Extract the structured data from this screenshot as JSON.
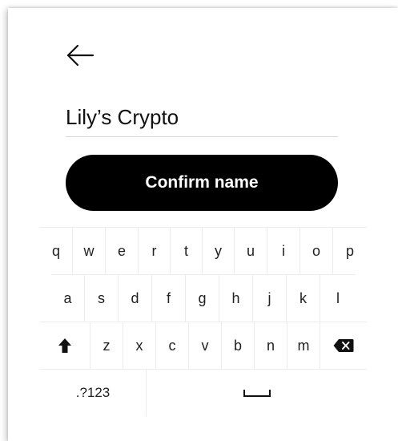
{
  "header": {
    "back_icon": "arrow-left-icon"
  },
  "name_input": {
    "value": "Lily’s Crypto"
  },
  "confirm_button": {
    "label": "Confirm name"
  },
  "keyboard": {
    "row1": [
      "q",
      "w",
      "e",
      "r",
      "t",
      "y",
      "u",
      "i",
      "o",
      "p"
    ],
    "row2": [
      "a",
      "s",
      "d",
      "f",
      "g",
      "h",
      "j",
      "k",
      "l"
    ],
    "row3": [
      "z",
      "x",
      "c",
      "v",
      "b",
      "n",
      "m"
    ],
    "shift_icon": "shift-arrow-icon",
    "backspace_icon": "backspace-icon",
    "symbols_label": ".?123",
    "space_icon": "space-bar-icon"
  },
  "colors": {
    "button_bg": "#000000",
    "button_text": "#ffffff",
    "text": "#111111",
    "divider": "#ececec"
  }
}
